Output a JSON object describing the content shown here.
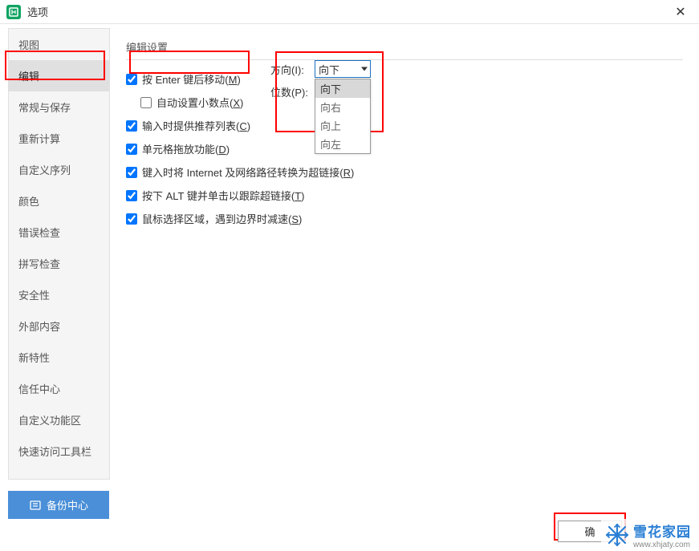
{
  "title": "选项",
  "sidebar": {
    "items": [
      {
        "label": "视图"
      },
      {
        "label": "编辑"
      },
      {
        "label": "常规与保存"
      },
      {
        "label": "重新计算"
      },
      {
        "label": "自定义序列"
      },
      {
        "label": "颜色"
      },
      {
        "label": "错误检查"
      },
      {
        "label": "拼写检查"
      },
      {
        "label": "安全性"
      },
      {
        "label": "外部内容"
      },
      {
        "label": "新特性"
      },
      {
        "label": "信任中心"
      },
      {
        "label": "自定义功能区"
      },
      {
        "label": "快速访问工具栏"
      }
    ],
    "active_index": 1
  },
  "section_title": "编辑设置",
  "checkboxes": [
    {
      "checked": true,
      "label": "按 Enter 键后移动(",
      "key": "M",
      "suffix": ")"
    },
    {
      "checked": false,
      "label": "自动设置小数点(",
      "key": "X",
      "suffix": ")"
    },
    {
      "checked": true,
      "label": "输入时提供推荐列表(",
      "key": "C",
      "suffix": ")"
    },
    {
      "checked": true,
      "label": "单元格拖放功能(",
      "key": "D",
      "suffix": ")"
    },
    {
      "checked": true,
      "label": "键入时将 Internet 及网络路径转换为超链接(",
      "key": "R",
      "suffix": ")"
    },
    {
      "checked": true,
      "label": "按下 ALT 键并单击以跟踪超链接(",
      "key": "T",
      "suffix": ")"
    },
    {
      "checked": true,
      "label": "鼠标选择区域，遇到边界时减速(",
      "key": "S",
      "suffix": ")"
    }
  ],
  "direction": {
    "label": "方向(",
    "key": "I",
    "suffix": "):",
    "value": "向下",
    "options": [
      "向下",
      "向右",
      "向上",
      "向左"
    ]
  },
  "digits": {
    "label": "位数(",
    "key": "P",
    "suffix": "):"
  },
  "backup_button": "备份中心",
  "ok_button": "确",
  "watermark": {
    "name": "雪花家园",
    "url": "www.xhjaty.com"
  }
}
